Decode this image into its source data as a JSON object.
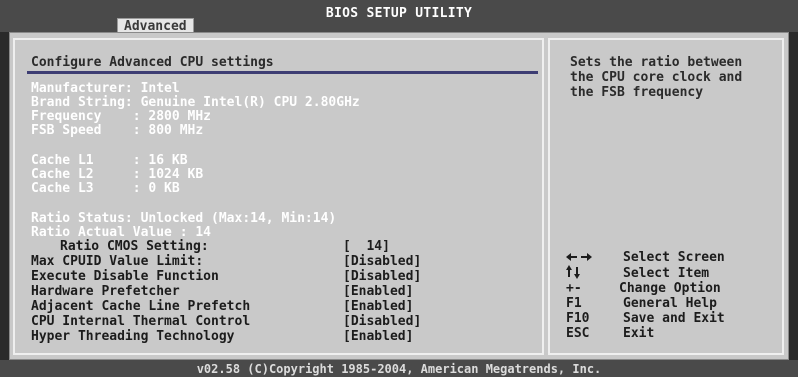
{
  "header": {
    "title": "BIOS SETUP UTILITY",
    "active_tab": "Advanced"
  },
  "main": {
    "section_title": "Configure Advanced CPU settings",
    "info_lines": [
      "Manufacturer: Intel",
      "Brand String: Genuine Intel(R) CPU 2.80GHz",
      "Frequency    : 2800 MHz",
      "FSB Speed    : 800 MHz",
      "Cache L1     : 16 KB",
      "Cache L2     : 1024 KB",
      "Cache L3     : 0 KB",
      "Ratio Status: Unlocked (Max:14, Min:14)",
      "Ratio Actual Value : 14"
    ],
    "settings": [
      {
        "label": "Ratio CMOS Setting:",
        "value": "[  14]"
      },
      {
        "label": "Max CPUID Value Limit:",
        "value": "[Disabled]"
      },
      {
        "label": "Execute Disable Function",
        "value": "[Disabled]"
      },
      {
        "label": "Hardware Prefetcher",
        "value": "[Enabled]"
      },
      {
        "label": "Adjacent Cache Line Prefetch",
        "value": "[Enabled]"
      },
      {
        "label": "CPU Internal Thermal Control",
        "value": "[Disabled]"
      },
      {
        "label": "Hyper Threading Technology",
        "value": "[Enabled]"
      }
    ]
  },
  "help": {
    "text": "Sets the ratio between the CPU core clock and the FSB frequency",
    "keys": [
      {
        "key": "←→",
        "key_icon": "left-right-arrows-icon",
        "desc": "Select Screen"
      },
      {
        "key": "↑↓",
        "key_icon": "up-down-arrows-icon",
        "desc": "Select Item"
      },
      {
        "key": "+-",
        "desc": "Change Option"
      },
      {
        "key": "F1",
        "desc": "General Help"
      },
      {
        "key": "F10",
        "desc": "Save and Exit"
      },
      {
        "key": "ESC",
        "desc": "Exit"
      }
    ]
  },
  "footer": {
    "copyright": "v02.58 (C)Copyright 1985-2004, American Megatrends, Inc."
  },
  "colors": {
    "bar": "#4a4a4a",
    "panel": "#c9c9c9",
    "info_text": "#ffffff",
    "setting_text": "#1c1c1c",
    "underline": "#3d3d73"
  }
}
